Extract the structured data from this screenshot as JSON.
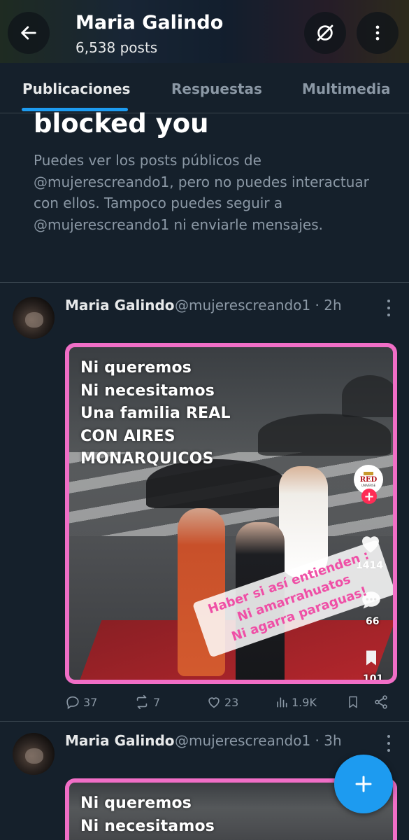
{
  "header": {
    "name": "Maria Galindo",
    "posts": "6,538 posts"
  },
  "tabs": [
    {
      "label": "Publicaciones",
      "active": true
    },
    {
      "label": "Respuestas",
      "active": false
    },
    {
      "label": "Multimedia",
      "active": false
    }
  ],
  "blocked": {
    "title": "blocked you",
    "description": "Puedes ver los posts públicos de @mujerescreando1, pero no puedes interactuar con ellos. Tampoco puedes seguir a @mujerescreando1 ni enviarle mensajes."
  },
  "posts": [
    {
      "name": "Maria Galindo",
      "handle": "@mujerescreando1 · 2h",
      "overlay_lines": [
        "Ni queremos",
        "Ni necesitamos",
        "Una familia REAL",
        "CON AIRES",
        "MONARQUICOS"
      ],
      "sticker_lines": [
        "Haber si así entienden :",
        "Ni amarrahuatos",
        "Ni agarra paraguas!"
      ],
      "channel_logo": {
        "text": "RED",
        "sub": "UNIVERSE"
      },
      "video_likes": "1414",
      "video_comments": "66",
      "video_saves": "101",
      "replies": "37",
      "reposts": "7",
      "likes": "23",
      "views": "1.9K"
    },
    {
      "name": "Maria Galindo",
      "handle": "@mujerescreando1 · 3h",
      "overlay_lines": [
        "Ni queremos",
        "Ni necesitamos"
      ]
    }
  ],
  "colors": {
    "background": "#15202b",
    "accent": "#1d9bf0",
    "muted": "#8b98a5",
    "media_border": "#f06ec6"
  },
  "icons": [
    "back-arrow-icon",
    "no-share-icon",
    "more-vertical-icon",
    "reply-icon",
    "repost-icon",
    "like-icon",
    "views-icon",
    "bookmark-icon",
    "share-icon",
    "compose-plus-icon"
  ]
}
